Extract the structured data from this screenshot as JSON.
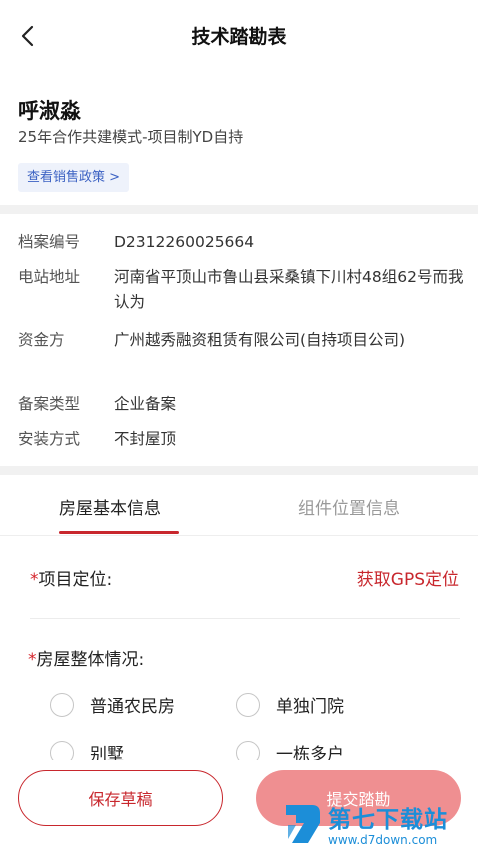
{
  "header": {
    "title": "技术踏勘表",
    "back_icon": "chevron-left-icon"
  },
  "customer": {
    "name": "呼淑淼",
    "mode": "25年合作共建模式-项目制YD自持",
    "policy_link": "查看销售政策 >"
  },
  "info": [
    {
      "label": "档案编号",
      "value": "D2312260025664"
    },
    {
      "label": "电站地址",
      "value": "河南省平顶山市鲁山县采桑镇下川村48组62号而我认为"
    },
    {
      "label": "资金方",
      "value": "广州越秀融资租赁有限公司(自持项目公司)"
    },
    {
      "label": "备案类型",
      "value": "企业备案"
    },
    {
      "label": "安装方式",
      "value": "不封屋顶"
    }
  ],
  "tabs": [
    {
      "label": "房屋基本信息",
      "active": true
    },
    {
      "label": "组件位置信息",
      "active": false
    }
  ],
  "form": {
    "required_mark": "*",
    "location_label": "项目定位:",
    "gps_button": "获取GPS定位",
    "house_label": "房屋整体情况:",
    "options": [
      "普通农民房",
      "单独门院",
      "别墅",
      "一栋多户"
    ]
  },
  "actions": {
    "draft": "保存草稿",
    "submit": "提交踏勘"
  },
  "watermark": {
    "cn": "第七下载站",
    "en": "www.d7down.com"
  },
  "colors": {
    "accent": "#c8272d",
    "link": "#3c62c3",
    "watermark": "#1c8ed8"
  }
}
